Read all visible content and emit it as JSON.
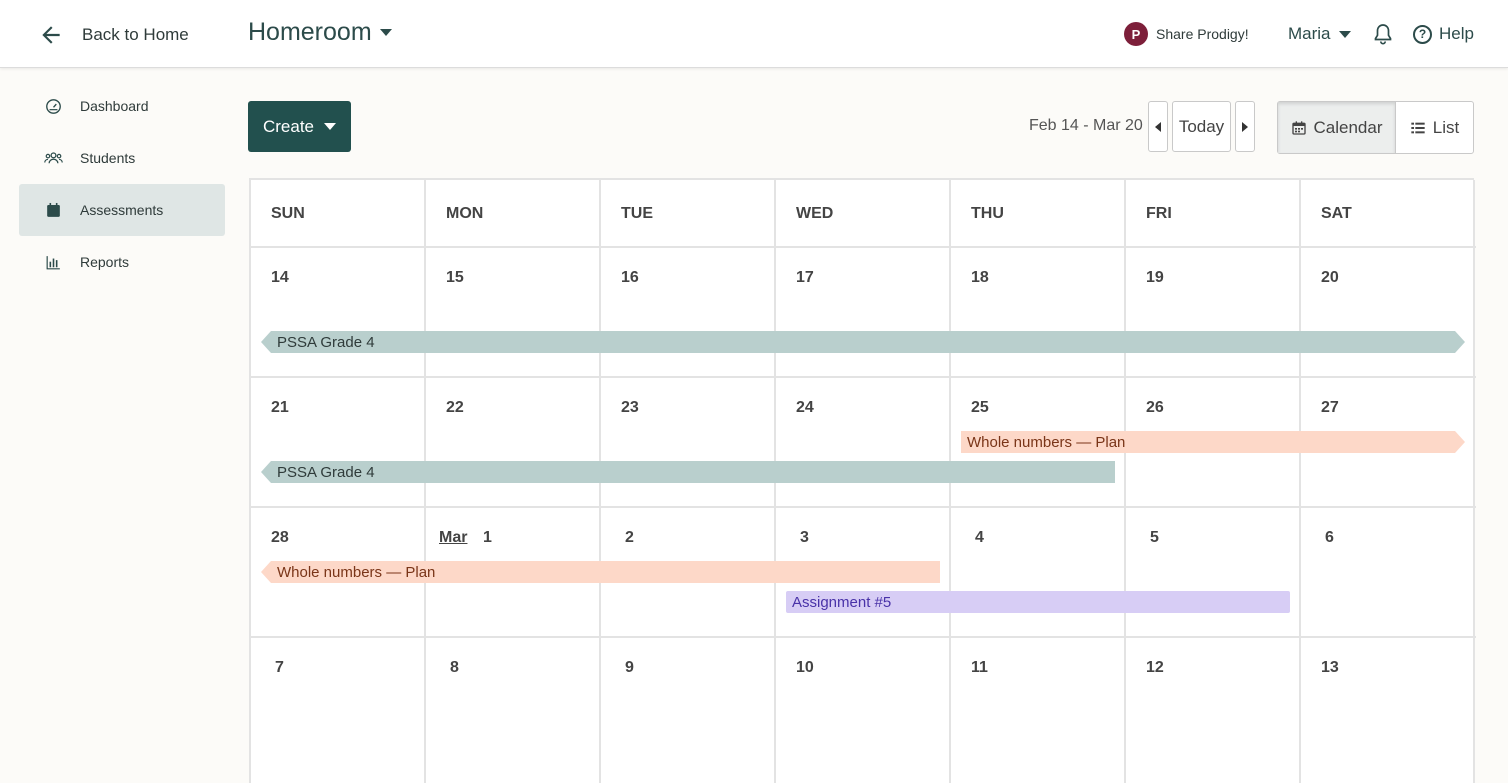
{
  "header": {
    "back_label": "Back to Home",
    "class_title": "Homeroom",
    "share_label": "Share Prodigy!",
    "share_logo": "P",
    "user_name": "Maria",
    "help_label": "Help",
    "help_glyph": "?"
  },
  "sidebar": {
    "items": [
      {
        "label": "Dashboard",
        "icon": "gauge-icon"
      },
      {
        "label": "Students",
        "icon": "students-icon"
      },
      {
        "label": "Assessments",
        "icon": "calendar-icon",
        "active": true
      },
      {
        "label": "Reports",
        "icon": "bar-chart-icon"
      }
    ]
  },
  "toolbar": {
    "create_label": "Create",
    "date_range": "Feb 14 - Mar 20",
    "today_label": "Today",
    "calendar_label": "Calendar",
    "list_label": "List"
  },
  "calendar": {
    "weekdays": [
      "SUN",
      "MON",
      "TUE",
      "WED",
      "THU",
      "FRI",
      "SAT"
    ],
    "weeks": [
      [
        "14",
        "15",
        "16",
        "17",
        "18",
        "19",
        "20"
      ],
      [
        "21",
        "22",
        "23",
        "24",
        "25",
        "26",
        "27"
      ],
      [
        "28",
        "1",
        "2",
        "3",
        "4",
        "5",
        "6"
      ],
      [
        "7",
        "8",
        "9",
        "10",
        "11",
        "12",
        "13"
      ]
    ],
    "month_marker": "Mar",
    "events": [
      {
        "title": "PSSA Grade 4",
        "color": "gray"
      },
      {
        "title": "Whole numbers — Plan",
        "color": "peach"
      },
      {
        "title": "PSSA Grade 4",
        "color": "gray"
      },
      {
        "title": "Whole numbers — Plan",
        "color": "peach"
      },
      {
        "title": "Assignment #5",
        "color": "purple"
      }
    ]
  },
  "colors": {
    "primary": "#22504e",
    "event_gray": "#b9cfcd",
    "event_peach": "#fdd8c8",
    "event_purple": "#d7cdf5"
  }
}
